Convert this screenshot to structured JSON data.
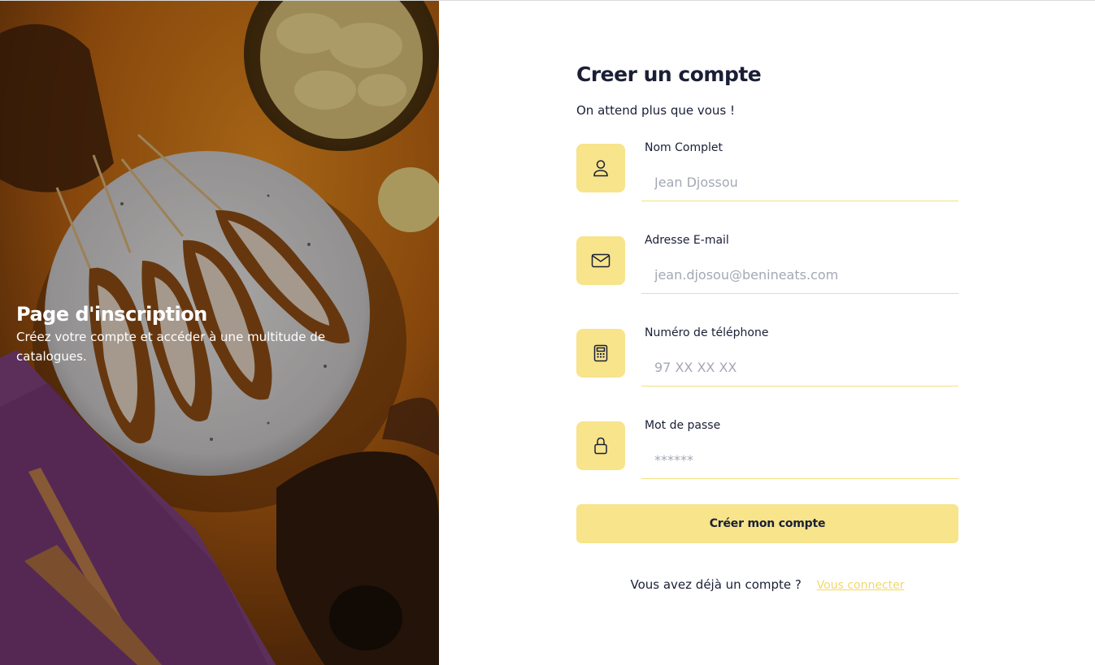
{
  "hero": {
    "title": "Page d'inscription",
    "subtitle": "Créez votre compte et accéder à une multitude de catalogues."
  },
  "form": {
    "title": "Creer un compte",
    "subtitle": "On attend plus que vous !",
    "fields": [
      {
        "label": "Nom Complet",
        "placeholder": "Jean Djossou",
        "icon": "user-icon"
      },
      {
        "label": "Adresse E-mail",
        "placeholder": "jean.djosou@benineats.com",
        "icon": "mail-icon"
      },
      {
        "label": "Numéro de téléphone",
        "placeholder": "97 XX XX XX",
        "icon": "calculator-icon"
      },
      {
        "label": "Mot de passe",
        "placeholder": "******",
        "icon": "lock-icon"
      }
    ],
    "submit_label": "Créer mon compte",
    "login_prompt": "Vous avez déjà un compte ?",
    "login_link": "Vous connecter"
  },
  "colors": {
    "accent": "#f7e48b",
    "text": "#1a1f36",
    "link": "#f1d86a"
  }
}
